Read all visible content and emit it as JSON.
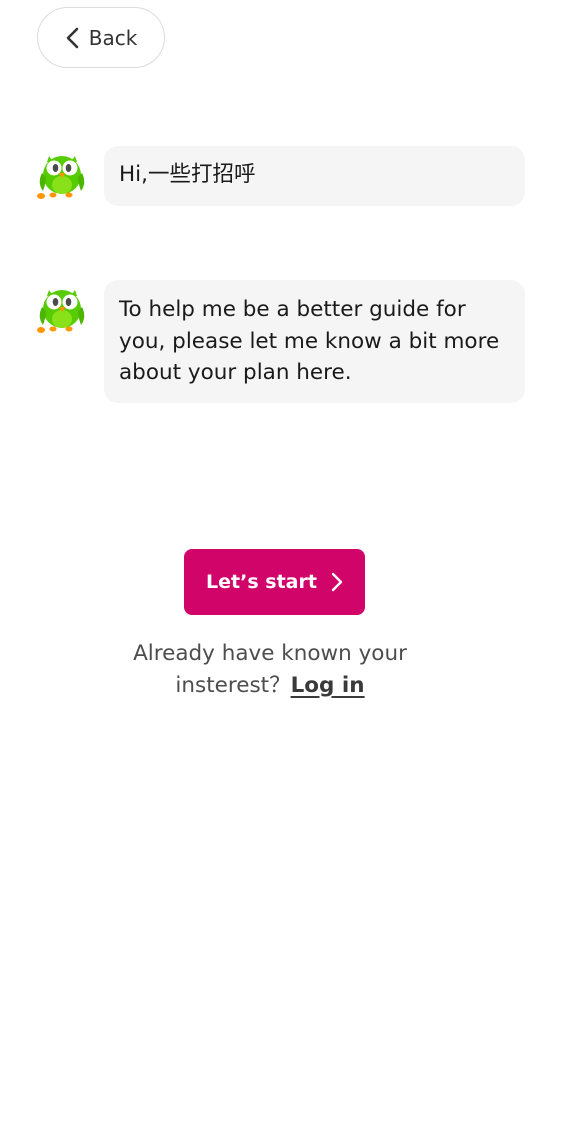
{
  "nav": {
    "back_label": "Back",
    "back_icon": "chevron-left-icon"
  },
  "messages": [
    {
      "avatar": "owl-mascot-icon",
      "text": "Hi,一些打招呼"
    },
    {
      "avatar": "owl-mascot-icon",
      "text": "To help me be a better guide for you, please let me know a bit more about your plan here."
    }
  ],
  "cta": {
    "label": "Let’s start",
    "icon": "chevron-right-icon",
    "color": "#d1046a"
  },
  "login": {
    "line1": "Already have known your",
    "line2": "insterest？",
    "link_label": "Log in"
  },
  "colors": {
    "bubble_bg": "#f5f5f5",
    "owl_green": "#58cc02"
  }
}
